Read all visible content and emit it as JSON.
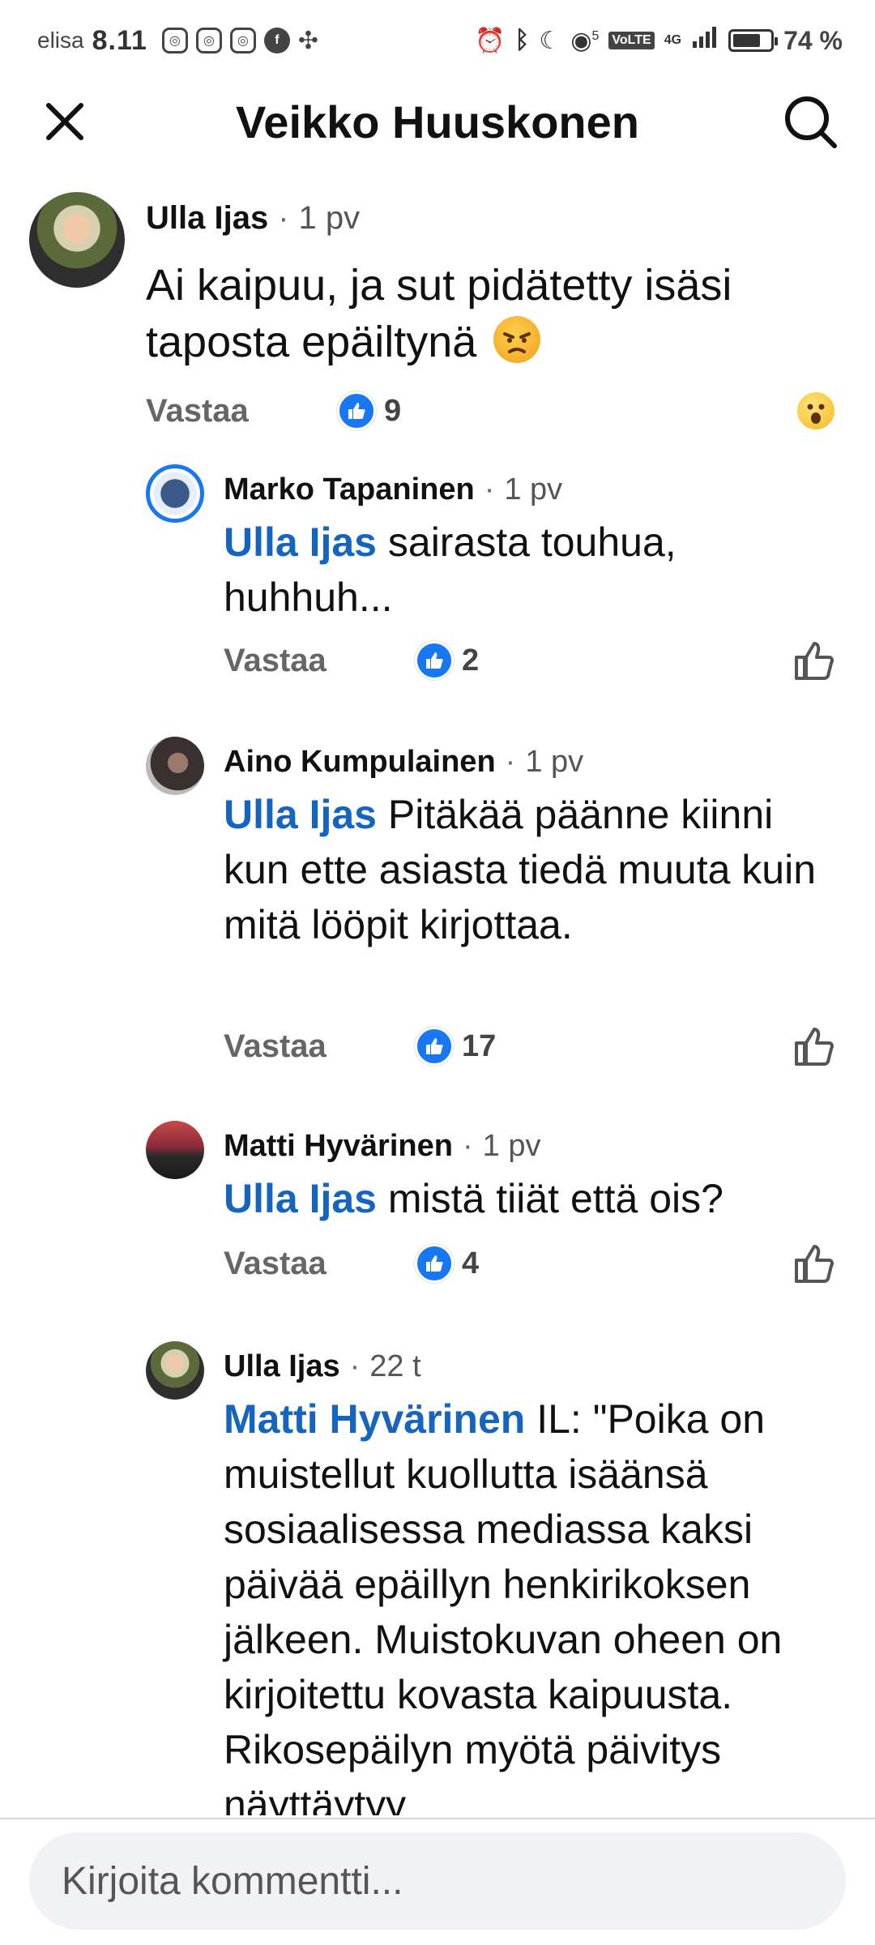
{
  "status_bar": {
    "carrier": "elisa",
    "time": "8.11",
    "signal_sup": "5",
    "volte": "VoLTE",
    "network": "4G",
    "battery_pct": "74 %",
    "battery_level": 0.74
  },
  "header": {
    "title": "Veikko Huuskonen"
  },
  "comments": [
    {
      "author": "Ulla Ijas",
      "age": "1 pv",
      "text": "Ai kaipuu, ja sut pidätetty isäsi taposta epäiltynä",
      "emoji": "angry-face",
      "reply_label": "Vastaa",
      "likes": "9"
    },
    {
      "author": "Marko Tapaninen",
      "age": "1 pv",
      "mention": "Ulla Ijas",
      "text": " sairasta touhua, huhhuh...",
      "reply_label": "Vastaa",
      "likes": "2"
    },
    {
      "author": "Aino Kumpulainen",
      "age": "1 pv",
      "mention": "Ulla Ijas",
      "text": " Pitäkää päänne kiinni kun ette asiasta tiedä muuta kuin mitä lööpit kirjottaa.",
      "reply_label": "Vastaa",
      "likes": "17"
    },
    {
      "author": "Matti Hyvärinen",
      "age": "1 pv",
      "mention": "Ulla Ijas",
      "text": " mistä tiiät että ois?",
      "reply_label": "Vastaa",
      "likes": "4"
    },
    {
      "author": "Ulla Ijas",
      "age": "22 t",
      "mention": "Matti Hyvärinen",
      "text": " IL: \"Poika on muistellut kuollutta isäänsä sosiaalisessa mediassa kaksi päivää epäillyn henkirikoksen jälkeen. Muistokuvan oheen on kirjoitettu kovasta kaipuusta. Rikosepäilyn myötä päivitys näyttäytyy"
    }
  ],
  "composer": {
    "placeholder": "Kirjoita kommentti..."
  },
  "colors": {
    "accent": "#1877f2",
    "mention": "#1565c0"
  }
}
